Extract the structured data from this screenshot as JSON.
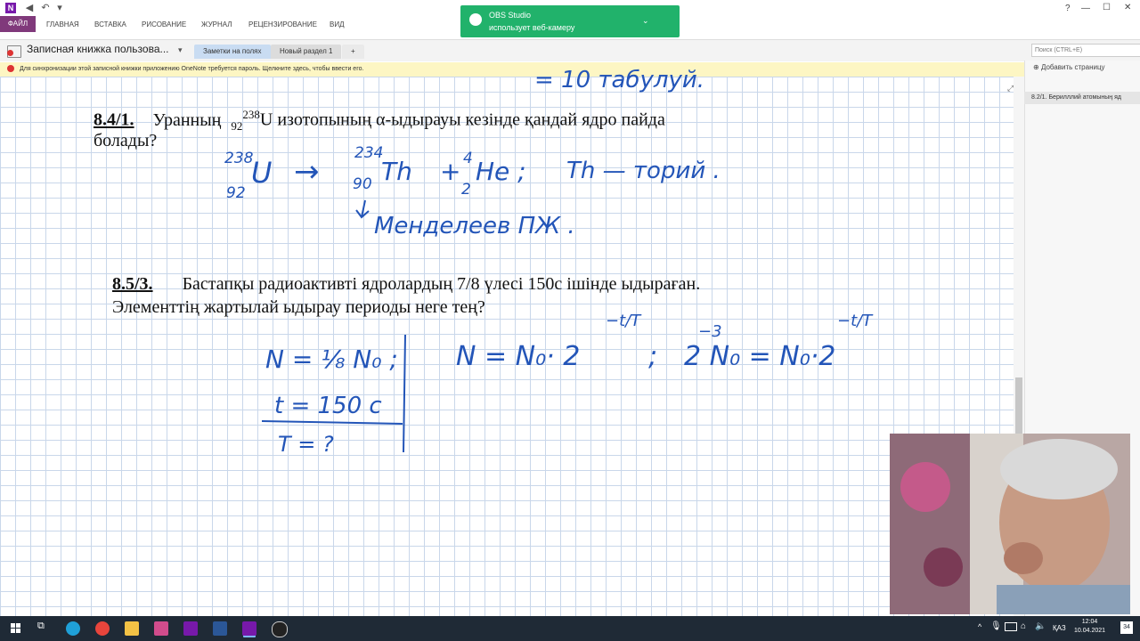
{
  "titlebar": {
    "notification_title": "OBS Studio",
    "notification_text": "использует веб-камеру",
    "help": "?",
    "minimize": "—",
    "restore": "☐",
    "close": "✕"
  },
  "ribbon": {
    "tabs": [
      "ФАЙЛ",
      "ГЛАВНАЯ",
      "ВСТАВКА",
      "РИСОВАНИЕ",
      "ЖУРНАЛ",
      "РЕЦЕНЗИРОВАНИЕ",
      "ВИД"
    ]
  },
  "notebook": {
    "name": "Записная книжка пользова...",
    "sections": [
      "Заметки на полях",
      "Новый раздел 1",
      "+"
    ],
    "search_placeholder": "Поиск (CTRL+E)"
  },
  "sync_warning": "Для синхронизации этой записной книжки приложению OneNote требуется пароль. Щелкните здесь, чтобы ввести его.",
  "right_panel": {
    "add_page": "Добавить страницу",
    "pages": [
      "8.2/1.   Берилллий атомының яд"
    ]
  },
  "problems": [
    {
      "number": "8.4/1.",
      "text_a": "Уранның",
      "sub": "92",
      "sup": "238",
      "text_b": "U изотопының α-ыдырауы кезінде қандай ядро пайда",
      "text_line2": "болады?"
    },
    {
      "number": "8.5/3.",
      "text_line1": "Бастапқы радиоактивті ядролардың 7/8 үлесі 150с ішінде ыдыраған.",
      "text_line2": "Элементтің жартылай ыдырау периоды неге тең?"
    }
  ],
  "handwriting": {
    "top_fragment": "= 10 табулуй.",
    "u_sup": "238",
    "u_sub": "92",
    "u": "U",
    "arrow": "→",
    "th_sup": "234",
    "th_sub": "90",
    "th": "Th",
    "plus": "+",
    "he_sup": "4",
    "he_sub": "2",
    "he": "He ;",
    "thorium": "Th — торий .",
    "mendeleev": "Менделеев ПЖ .",
    "given_n": "N = ⅛ N₀ ;",
    "given_t": "t = 150 c",
    "given_T": "T = ?",
    "formula1": "N = N₀· 2",
    "formula1_exp": "−t/T",
    "semicolon": ";",
    "formula2": "2  N₀ = N₀·2",
    "formula2_pre": "−3",
    "formula2_exp": "−t/T"
  },
  "taskbar": {
    "lang": "ҚАЗ",
    "time": "12:04",
    "date": "10.04.2021",
    "badge": "34"
  }
}
